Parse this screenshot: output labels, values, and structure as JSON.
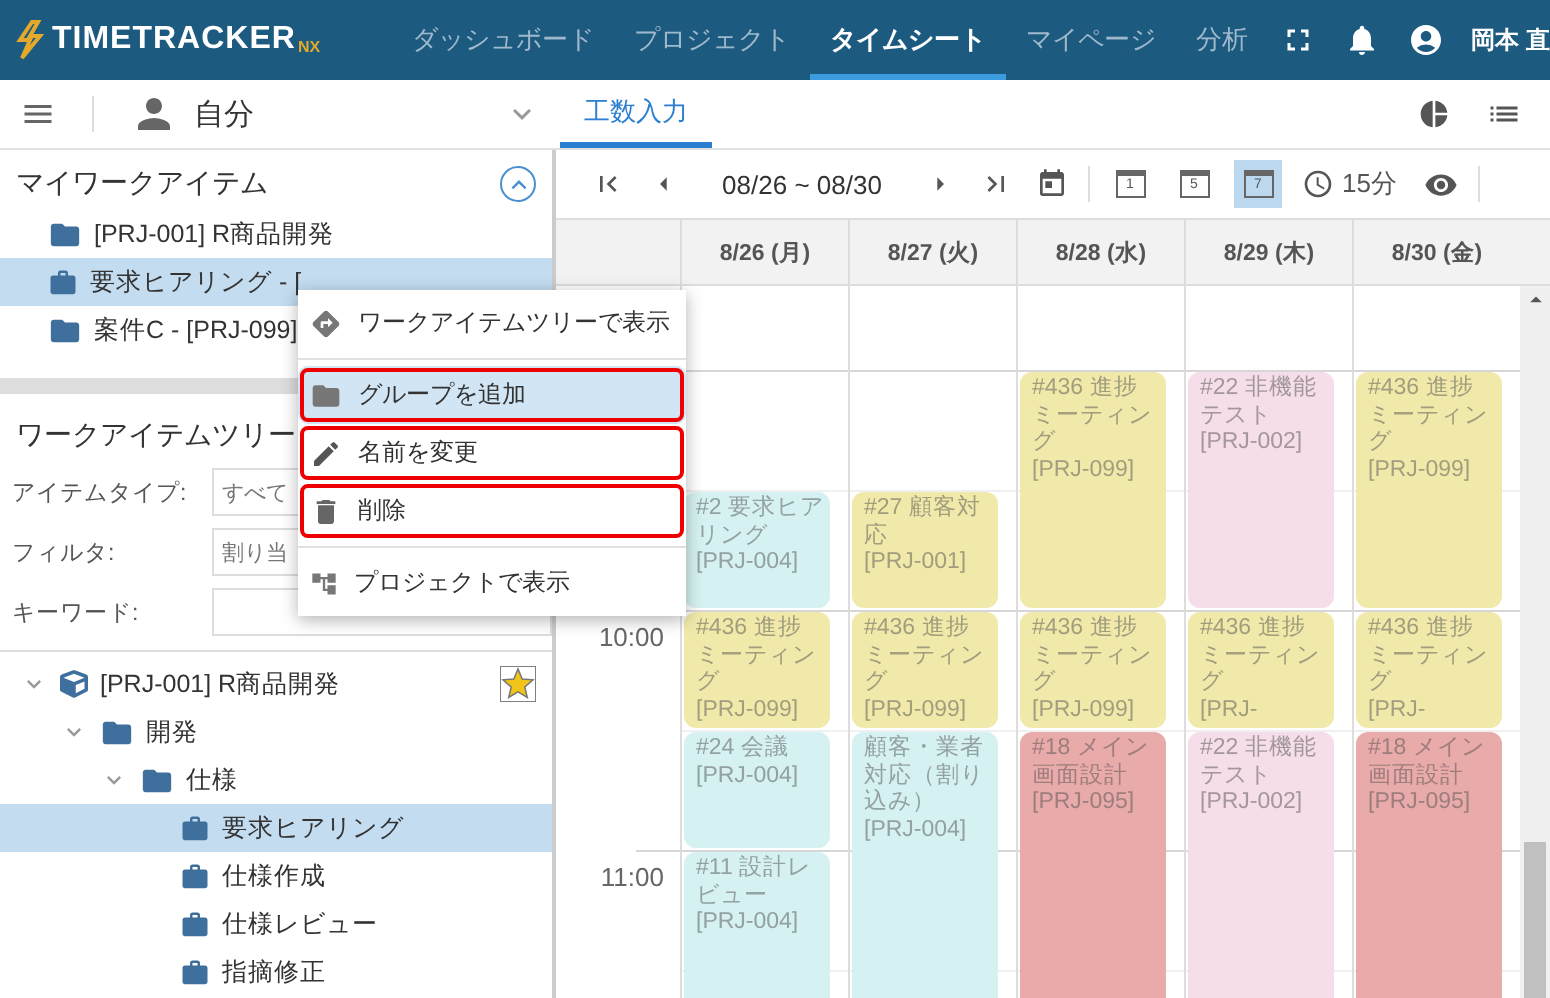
{
  "header": {
    "logo": "TIMETRACKER",
    "logo_suffix": "NX",
    "nav": [
      {
        "label": "ダッシュボード",
        "selected": false
      },
      {
        "label": "プロジェクト",
        "selected": false
      },
      {
        "label": "タイムシート",
        "selected": true
      },
      {
        "label": "マイページ",
        "selected": false
      },
      {
        "label": "分析",
        "selected": false
      }
    ],
    "user": "岡本 直"
  },
  "subheader": {
    "person": "自分",
    "tabs": [
      {
        "label": "工数入力",
        "selected": true
      }
    ]
  },
  "my_work_items": {
    "title": "マイワークアイテム",
    "items": [
      {
        "kind": "folder",
        "label": "[PRJ-001] R商品開発",
        "selected": false
      },
      {
        "kind": "task",
        "label": "要求ヒアリング - [",
        "selected": true
      },
      {
        "kind": "folder",
        "label": "案件C - [PRJ-099]",
        "selected": false
      }
    ]
  },
  "work_item_tree": {
    "title": "ワークアイテムツリー",
    "filters": [
      {
        "label": "アイテムタイプ:",
        "value": "すべて"
      },
      {
        "label": "フィルタ:",
        "value": "割り当"
      },
      {
        "label": "キーワード:"
      }
    ],
    "tree": [
      {
        "kind": "project",
        "label": "[PRJ-001] R商品開発",
        "expanded": true,
        "starred": true,
        "selected": false,
        "children": [
          {
            "kind": "folder",
            "label": "開発",
            "expanded": true,
            "selected": false,
            "children": [
              {
                "kind": "folder",
                "label": "仕様",
                "expanded": true,
                "selected": false,
                "children": [
                  {
                    "kind": "task",
                    "label": "要求ヒアリング",
                    "selected": true
                  },
                  {
                    "kind": "task",
                    "label": "仕様作成",
                    "selected": false
                  },
                  {
                    "kind": "task",
                    "label": "仕様レビュー",
                    "selected": false
                  },
                  {
                    "kind": "task",
                    "label": "指摘修正",
                    "selected": false
                  }
                ]
              }
            ]
          }
        ]
      }
    ]
  },
  "context_menu": {
    "groups": [
      [
        {
          "label": "ワークアイテムツリーで表示",
          "selected": false,
          "highlighted": false
        }
      ],
      [
        {
          "label": "グループを追加",
          "selected": true,
          "highlighted": true
        },
        {
          "label": "名前を変更",
          "selected": false,
          "highlighted": true
        },
        {
          "label": "削除",
          "selected": false,
          "highlighted": true
        }
      ],
      [
        {
          "label": "プロジェクトで表示",
          "selected": false,
          "highlighted": false
        }
      ]
    ]
  },
  "toolbar": {
    "range": "08/26 ~ 08/30",
    "views": [
      {
        "label": "1",
        "selected": false
      },
      {
        "label": "5",
        "selected": false
      },
      {
        "label": "7",
        "selected": true
      }
    ],
    "interval": "15分"
  },
  "calendar": {
    "times": [
      "10:00",
      "11:00"
    ],
    "days": [
      {
        "label": "8/26 (月)",
        "events": [
          {
            "title": "#2 要求ヒアリング",
            "project": "[PRJ-004]",
            "color": "#d6f1f1"
          },
          {
            "title": "#436 進捗ミーティング",
            "project": "[PRJ-099]",
            "color": "#f1e9aa"
          },
          {
            "title": "#24 会議",
            "project": "[PRJ-004]",
            "color": "#d6f1f1"
          },
          {
            "title": "#11 設計レビュー",
            "project": "[PRJ-004]",
            "color": "#d6f1f1"
          }
        ]
      },
      {
        "label": "8/27 (火)",
        "events": [
          {
            "title": "#27 顧客対応",
            "project": "[PRJ-001]",
            "color": "#f1e9aa"
          },
          {
            "title": "#436 進捗ミーティング",
            "project": "[PRJ-099]",
            "color": "#f1e9aa"
          },
          {
            "title": "顧客・業者対応（割り込み）",
            "project": "[PRJ-004]",
            "color": "#d6f1f1"
          }
        ]
      },
      {
        "label": "8/28 (水)",
        "events": [
          {
            "title": "#436 進捗ミーティング",
            "project": "[PRJ-099]",
            "color": "#f1e9aa"
          },
          {
            "title": "#436 進捗ミーティング",
            "project": "[PRJ-099]",
            "color": "#f1e9aa"
          },
          {
            "title": "#18 メイン画面設計",
            "project": "[PRJ-095]",
            "color": "#e9aaaa"
          }
        ]
      },
      {
        "label": "8/29 (木)",
        "events": [
          {
            "title": "#22 非機能テスト",
            "project": "[PRJ-002]",
            "color": "#f5dde9"
          },
          {
            "title": "#436 進捗ミーティング",
            "project": "[PRJ-",
            "color": "#f1e9aa"
          },
          {
            "title": "#22 非機能テスト",
            "project": "[PRJ-002]",
            "color": "#f5dde9"
          }
        ]
      },
      {
        "label": "8/30 (金)",
        "events": [
          {
            "title": "#436 進捗ミーティング",
            "project": "[PRJ-099]",
            "color": "#f1e9aa"
          },
          {
            "title": "#436 進捗ミーティング",
            "project": "[PRJ-",
            "color": "#f1e9aa"
          },
          {
            "title": "#18 メイン画面設計",
            "project": "[PRJ-095]",
            "color": "#e9aaaa"
          }
        ]
      }
    ]
  }
}
